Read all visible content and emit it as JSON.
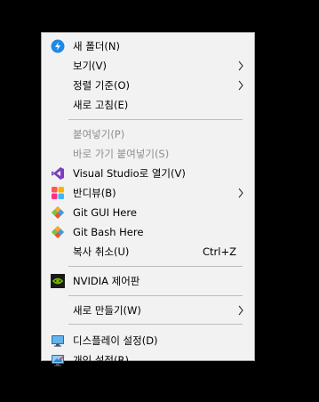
{
  "menu": {
    "new_folder": "새 폴더(N)",
    "view": "보기(V)",
    "sort_by": "정렬 기준(O)",
    "refresh": "새로 고침(E)",
    "paste": "붙여넣기(P)",
    "paste_shortcut": "바로 가기 붙여넣기(S)",
    "open_vs": "Visual Studio로 열기(V)",
    "bandiview": "반디뷰(B)",
    "git_gui": "Git GUI Here",
    "git_bash": "Git Bash Here",
    "undo_delete": "복사 취소(U)",
    "undo_shortcut": "Ctrl+Z",
    "nvidia": "NVIDIA 제어판",
    "new": "새로 만들기(W)",
    "display_settings": "디스플레이 설정(D)",
    "personalize": "개인 설정(R)"
  },
  "icons": {
    "new_folder": "lightning-icon",
    "visual_studio": "visual-studio-icon",
    "bandiview": "bandiview-icon",
    "git": "git-icon",
    "nvidia": "nvidia-icon",
    "display": "monitor-icon",
    "personalize": "personalize-icon"
  },
  "colors": {
    "menu_bg": "#f2f2f2",
    "disabled_text": "#8d8d8d",
    "separator": "#bdbdbd"
  }
}
